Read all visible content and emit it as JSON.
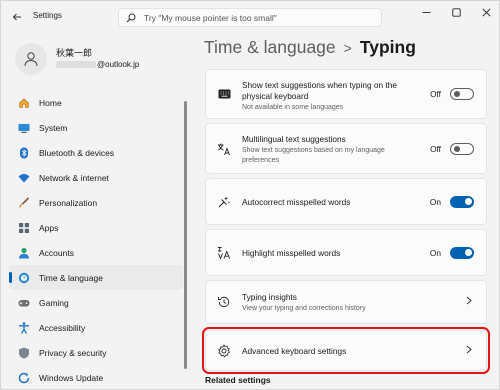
{
  "window": {
    "title": "Settings",
    "search_placeholder": "Try \"My mouse pointer is too small\""
  },
  "profile": {
    "name": "秋葉一郎",
    "email_domain": "@outlook.jp"
  },
  "sidebar": {
    "items": [
      {
        "label": "Home",
        "icon": "home-icon",
        "active": false
      },
      {
        "label": "System",
        "icon": "monitor-icon",
        "active": false
      },
      {
        "label": "Bluetooth & devices",
        "icon": "bluetooth-icon",
        "active": false
      },
      {
        "label": "Network & internet",
        "icon": "wifi-icon",
        "active": false
      },
      {
        "label": "Personalization",
        "icon": "paintbrush-icon",
        "active": false
      },
      {
        "label": "Apps",
        "icon": "apps-icon",
        "active": false
      },
      {
        "label": "Accounts",
        "icon": "person-icon",
        "active": false
      },
      {
        "label": "Time & language",
        "icon": "globe-clock-icon",
        "active": true
      },
      {
        "label": "Gaming",
        "icon": "gamepad-icon",
        "active": false
      },
      {
        "label": "Accessibility",
        "icon": "accessibility-icon",
        "active": false
      },
      {
        "label": "Privacy & security",
        "icon": "shield-icon",
        "active": false
      },
      {
        "label": "Windows Update",
        "icon": "update-icon",
        "active": false
      }
    ]
  },
  "breadcrumb": {
    "parent": "Time & language",
    "separator": ">",
    "current": "Typing"
  },
  "settings": [
    {
      "title": "Show text suggestions when typing on the physical keyboard",
      "subtitle": "Not available in some languages",
      "control": "toggle",
      "state": "Off",
      "icon": "keyboard-icon"
    },
    {
      "title": "Multilingual text suggestions",
      "subtitle": "Show text suggestions based on my language preferences",
      "control": "toggle",
      "state": "Off",
      "icon": "multilingual-icon"
    },
    {
      "title": "Autocorrect misspelled words",
      "subtitle": "",
      "control": "toggle",
      "state": "On",
      "icon": "autocorrect-icon"
    },
    {
      "title": "Highlight misspelled words",
      "subtitle": "",
      "control": "toggle",
      "state": "On",
      "icon": "highlight-spelling-icon"
    },
    {
      "title": "Typing insights",
      "subtitle": "View your typing and corrections history",
      "control": "chevron",
      "icon": "history-icon"
    },
    {
      "title": "Advanced keyboard settings",
      "subtitle": "",
      "control": "chevron",
      "icon": "gear-icon",
      "highlighted": true
    }
  ],
  "related_heading": "Related settings",
  "colors": {
    "accent": "#0063b1",
    "highlight_border": "#e01616"
  }
}
